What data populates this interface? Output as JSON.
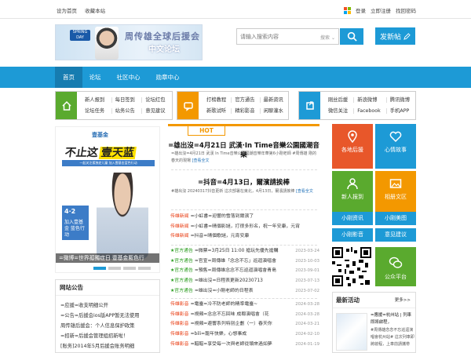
{
  "topbar": {
    "set_home": "设为首页",
    "bookmark": "收藏本站",
    "login": "登录",
    "register": "立即注册",
    "forgot": "找回密码"
  },
  "logo": {
    "badge": "SPRING DAY",
    "line1": "周传雄全球后援会",
    "line2": "中文论坛"
  },
  "search": {
    "placeholder": "请输入搜索内容",
    "scope": "搜索"
  },
  "post_button": "发新帖",
  "nav": [
    "首页",
    "论坛",
    "社区中心",
    "勋章中心"
  ],
  "quick": [
    {
      "color": "#5aaa2e",
      "links": [
        "新人报到",
        "每日签到",
        "论坛红包",
        "论坛任务",
        "站务公告",
        "意见建议"
      ]
    },
    {
      "color": "#f39800",
      "links": [
        "打榜教程",
        "官方通告",
        "最新资讯",
        "新歌试听",
        "精彩影音",
        "闲聊灌水"
      ]
    },
    {
      "color": "#1d9ad6",
      "links": [
        "刚丝后援",
        "新浪微博",
        "腾讯微博",
        "微信关注",
        "Facebook",
        "手机APP"
      ]
    }
  ],
  "banner": {
    "brand": "壹基金",
    "slogan_a": "不止这",
    "slogan_b": "壹天蓝",
    "strip": "一起关注孤独症儿童 加入壹基金蓝色行动",
    "date": "4·2",
    "date_text": "加入壹基金 蓝色行动",
    "caption": "=微博=世界孤獨症日 壹基金藍色行",
    "dots": [
      true,
      false,
      false,
      false
    ]
  },
  "notice": {
    "title": "网站公告",
    "items": [
      "=应援=收支明细公开",
      "=公告=后援会ios版APP暂无法使用",
      "周传雄后援会：个人信息保护政策",
      "=招新=后援会管理组招新啦！",
      "[账务]2014年5月后援会账务明细"
    ]
  },
  "hot": {
    "tag": "HOT",
    "headline1": "=雄出沒=4月21日 武漢·In Time音樂公園國潮音樂",
    "summary1": "=雄出沒=4月21日 武漢 In Time音樂公園國潮音樂年華第6小剛老師 #周傳雄 剛的春天的現場",
    "more1": "[查看全文",
    "headline2": "=抖音=4月13日，爾濱請挨棒",
    "summary2": "#雄出沒 20240317抖音更新 這次部署在東北，4月13日，爾濱請挨棒",
    "more2": "[查看全文"
  },
  "news": [
    {
      "tag": "传雄新闻",
      "text": "=小虹書=迎響的雪落到爾濱了",
      "date": ""
    },
    {
      "tag": "传雄新闻",
      "text": "=小虹書=晴個影謎，打很多形名，祝一年安康，元宵",
      "date": ""
    },
    {
      "tag": "传雄新闻",
      "text": "=抖音=晴個歌謎，元宵安康",
      "date": ""
    },
    {
      "tag": "★官方通告",
      "text": "=微票=3月25日 11:00 搶玩先優先搶購",
      "date": "2023-03-24"
    },
    {
      "tag": "★官方通告",
      "text": "=官宣=周傳雄「念念不忘」巡迴演唱會",
      "date": "2023-10-03"
    },
    {
      "tag": "★官方通告",
      "text": "=預售=周傳雄念念不忘巡迴演唱會青島",
      "date": "2023-09-01"
    },
    {
      "tag": "★官方通告",
      "text": "=雄出沒=日程表更新20230713",
      "date": "2023-07-13"
    },
    {
      "tag": "★官方通告",
      "text": "=雄出沒=小剛老師的日程表",
      "date": "2023-07-02"
    },
    {
      "tag": "传雄影音",
      "text": "=電臺=冷不防老師的精準電臺~",
      "date": "2024-03-28"
    },
    {
      "tag": "传雄影音",
      "text": "=視頻=念念不忘回味 成都演唱會（花",
      "date": "2024-03-28"
    },
    {
      "tag": "传雄影音",
      "text": "=視頻=避響系列特別企劃（一）春天你",
      "date": "2024-03-21"
    },
    {
      "tag": "传雄影音",
      "text": "=bili=龍年快樂，心想事成",
      "date": "2024-02-10"
    },
    {
      "tag": "传雄影音",
      "text": "=醋醋=享受每一次與老師從頭來過如夢",
      "date": "2024-01-19"
    }
  ],
  "tiles": {
    "backing": "各地后援",
    "mood": "心情故事",
    "news": "新人报到",
    "album": "相册文区",
    "info": "小刚资讯",
    "art": "小刚美图",
    "video": "小刚影音",
    "suggest": "意见建议",
    "public": "公众平台"
  },
  "latest": {
    "title": "最新活动",
    "more": "更多>>",
    "headline": "=應援=杭州站 | 列車即將啟程，",
    "desc": "#周傳雄念念不忘巡迴演唱會杭州站# 這次列車即將啟程，上車前請攜帶"
  }
}
